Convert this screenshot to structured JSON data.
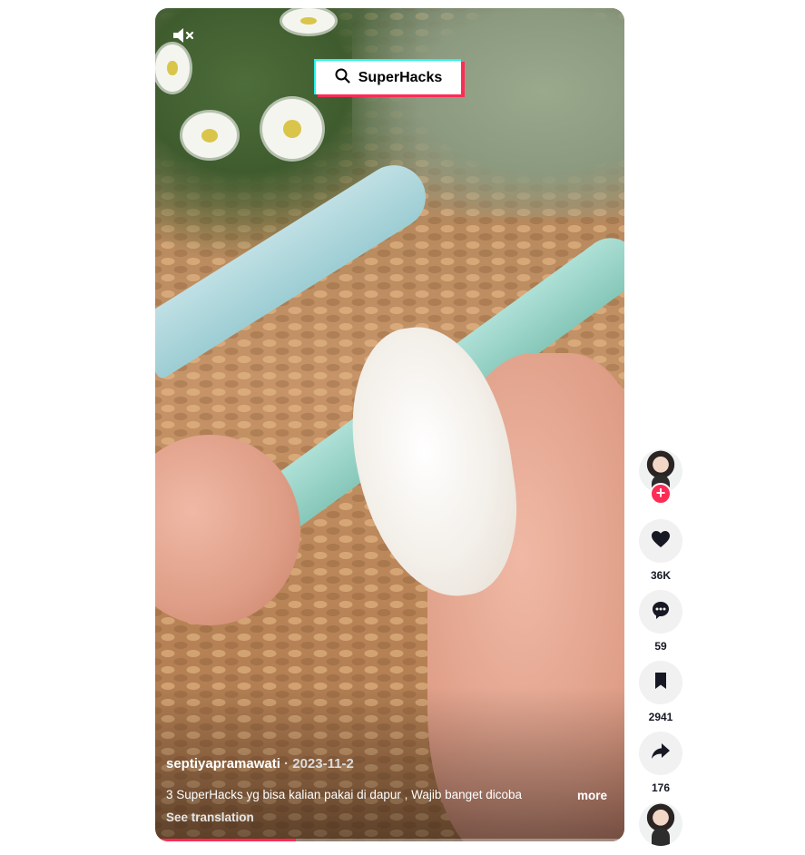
{
  "search_badge": {
    "text": "SuperHacks",
    "icon": "search-icon"
  },
  "post": {
    "author": "septiyapramawati",
    "date_separator": " · ",
    "date": "2023-11-2",
    "caption": "3 SuperHacks yg bisa kalian pakai di dapur , Wajib banget dicoba",
    "more_label": "more",
    "translate_label": "See translation",
    "progress": 0.3
  },
  "actions": {
    "likes": "36K",
    "comments": "59",
    "saves": "2941",
    "shares": "176"
  },
  "colors": {
    "accent": "#fe2c55",
    "badge_cyan": "#25f4ee",
    "button_bg": "#f1f1f2",
    "count_text": "#161823"
  }
}
